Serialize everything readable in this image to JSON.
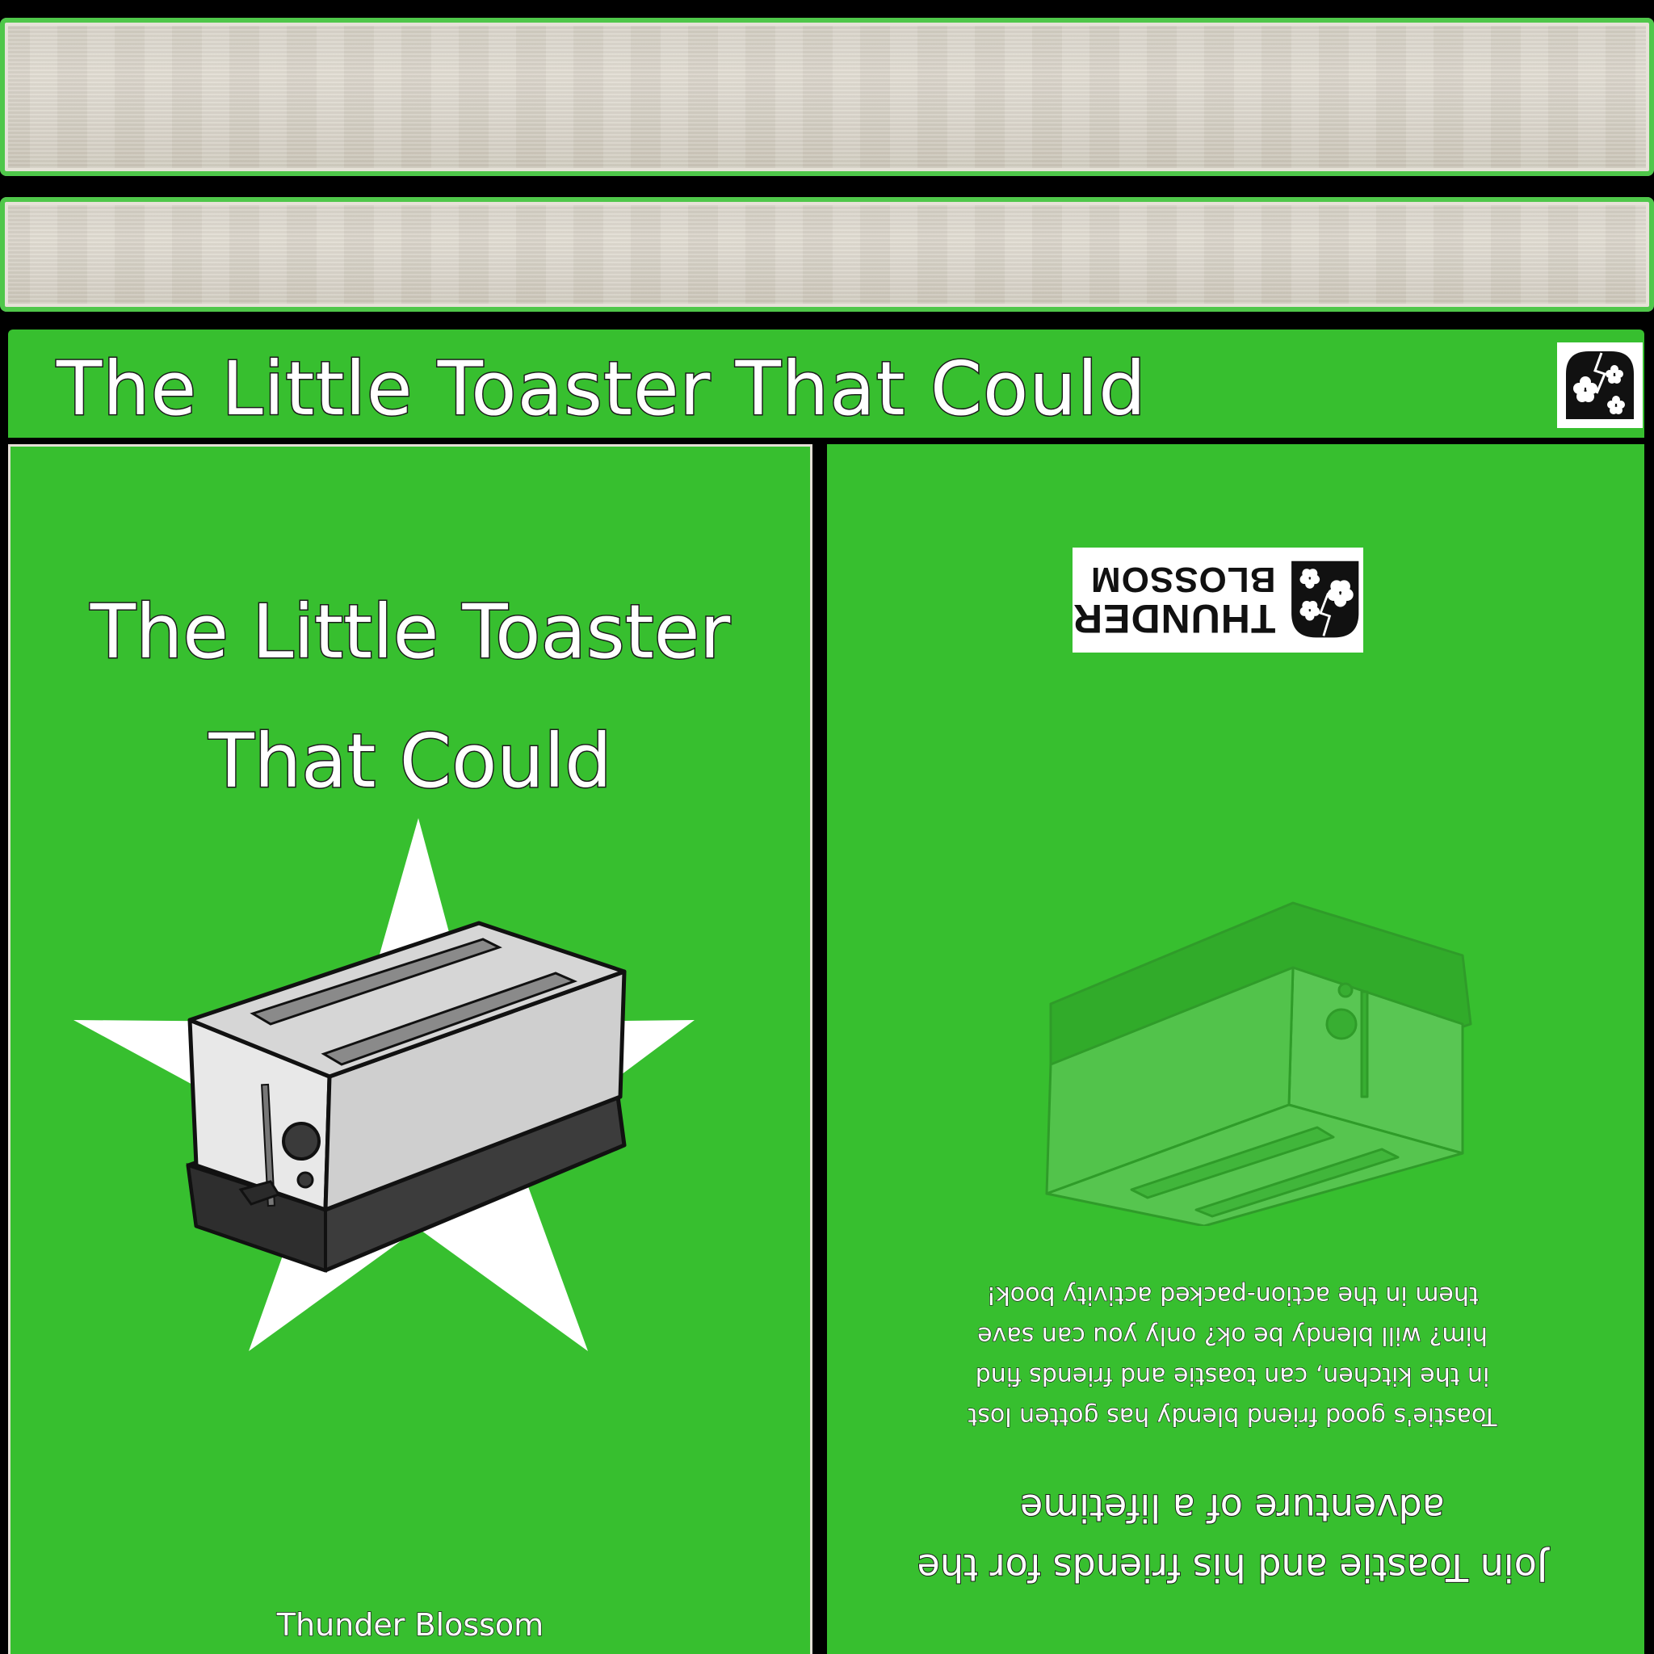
{
  "spine": {
    "title": "The Little Toaster That Could",
    "logo_icon": "thunder-blossom-mark-icon"
  },
  "front_cover": {
    "title_line1": "The Little Toaster",
    "title_line2": "That Could",
    "author": "Thunder Blossom",
    "illustration": "toaster-on-star"
  },
  "back_cover": {
    "orientation": "upside-down",
    "headline_line1": "Join Toastie and his friends for the",
    "headline_line2": "adventure of a lifetime",
    "body_lines": [
      "Toastie's good friend blendy has gotten lost",
      "in the kitchen, can toastie and friends find",
      "him? will blendy be ok? only you can save",
      "them in the action-packed activity book!"
    ],
    "publisher_line1": "THUNDER",
    "publisher_line2": "BLOSSOM",
    "illustration": "faded-toaster"
  },
  "colors": {
    "cover_green": "#37bf2f",
    "page_edge": "#d9d4c9",
    "background": "#000000",
    "star": "#ffffff",
    "toaster_body": "#d9d9d9",
    "toaster_base": "#3a3a3a"
  }
}
